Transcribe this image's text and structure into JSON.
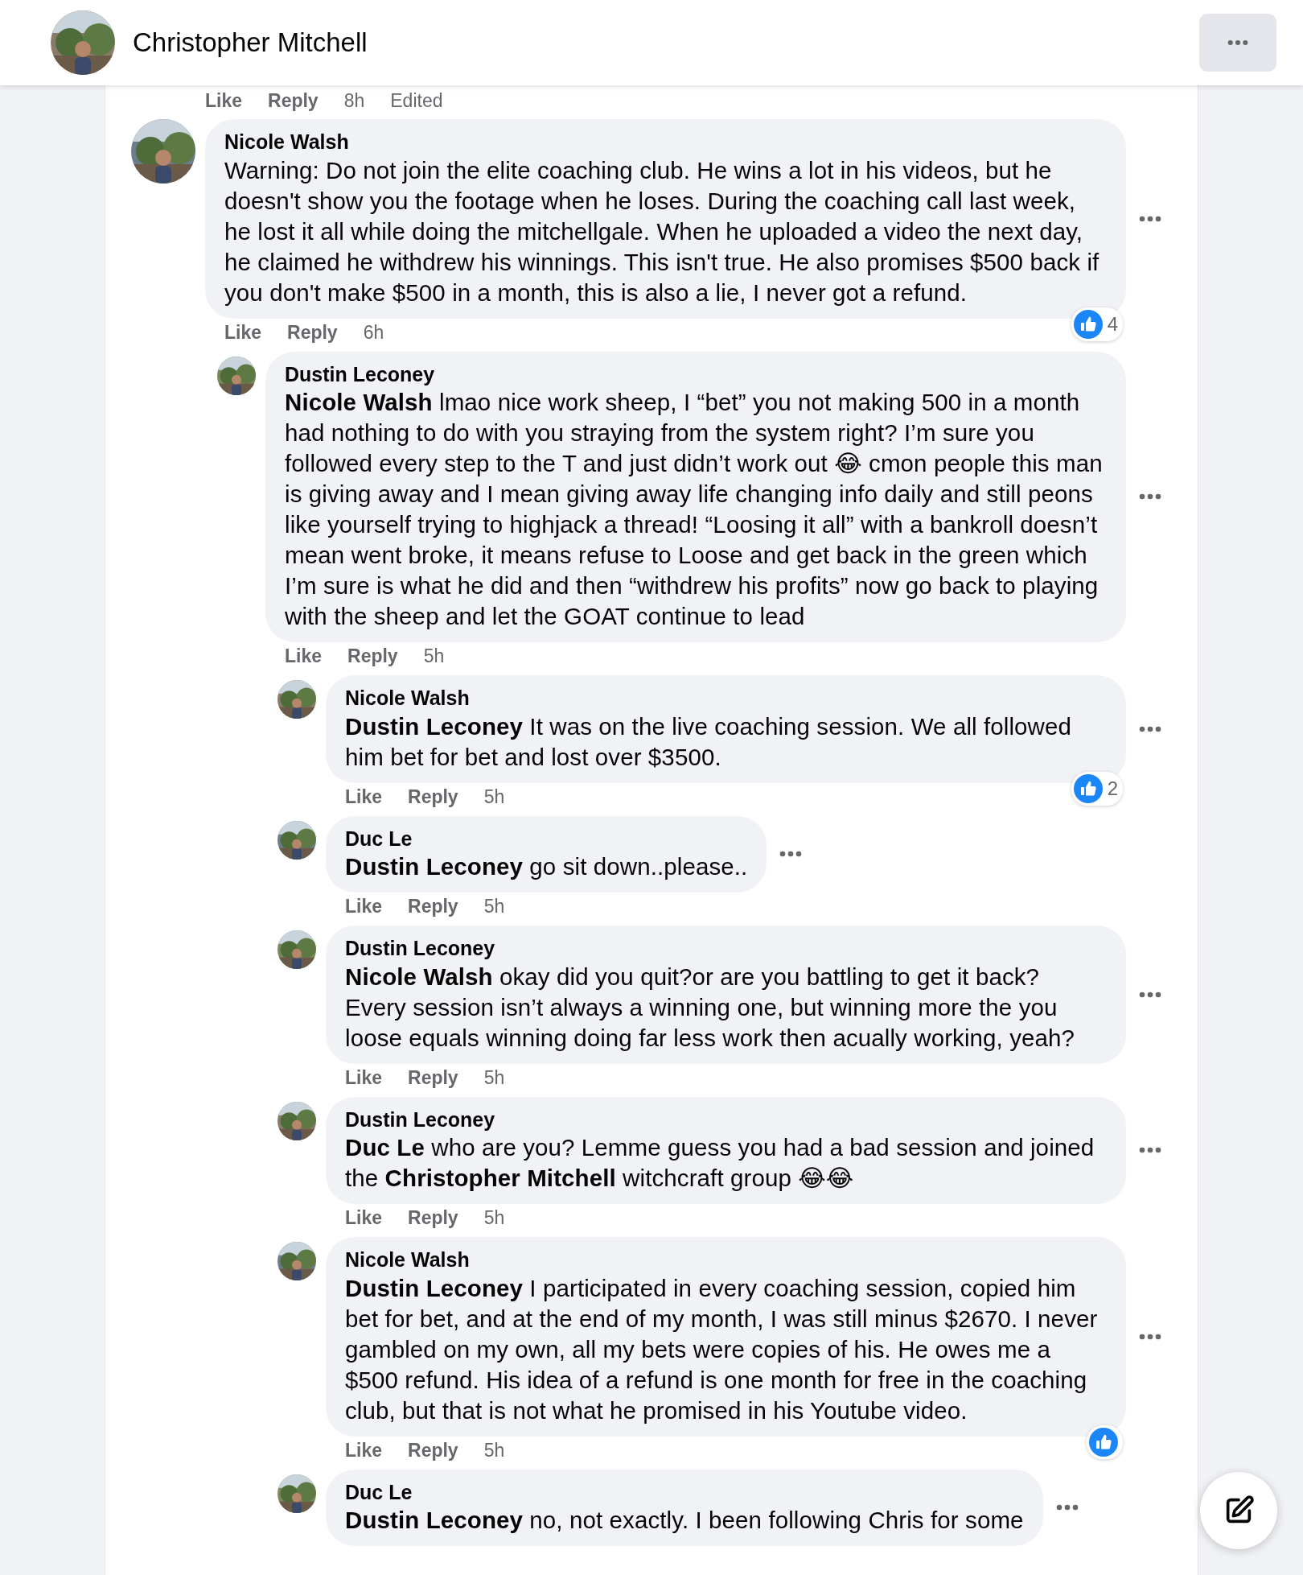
{
  "header": {
    "title": "Christopher Mitchell"
  },
  "top_actions": {
    "like": "Like",
    "reply": "Reply",
    "time": "8h",
    "edited": "Edited"
  },
  "comments": [
    {
      "author": "Nicole Walsh",
      "text": "Warning: Do not join the elite coaching club. He wins a lot in his videos, but he doesn't show you the footage when he loses. During the coaching call last week, he lost it all while doing the mitchellgale. When he uploaded a video the next day, he claimed he withdrew his winnings. This isn't true. He also promises $500 back if you don't make $500 in a month, this is also a lie, I never got a refund.",
      "like": "Like",
      "reply": "Reply",
      "time": "6h",
      "reaction": {
        "kind": "like",
        "count": "4"
      },
      "children": [
        {
          "author": "Dustin Leconey",
          "text": "**Nicole Walsh** lmao nice work sheep, I “bet” you not making 500 in a month had nothing to do with you straying from the system right? I’m sure you followed every step to the T and just didn’t work out 😂 cmon people this man is giving away and I mean giving away life changing info daily and still peons like yourself trying to highjack a thread! “Loosing it all” with a bankroll doesn’t mean went broke, it means refuse to Loose and get back in the green which I’m sure is what he did and then “withdrew his profits” now go back to playing with the sheep and let the GOAT continue to lead",
          "like": "Like",
          "reply": "Reply",
          "time": "5h",
          "children": [
            {
              "author": "Nicole Walsh",
              "text": "**Dustin Leconey** It was on the live coaching session. We all followed him bet for bet and lost over $3500.",
              "like": "Like",
              "reply": "Reply",
              "time": "5h",
              "reaction": {
                "kind": "like",
                "count": "2"
              }
            },
            {
              "author": "Duc Le",
              "text": "**Dustin Leconey** go sit down..please..",
              "like": "Like",
              "reply": "Reply",
              "time": "5h"
            },
            {
              "author": "Dustin Leconey",
              "text": "**Nicole Walsh** okay did you quit?or are you battling to get it back? Every session isn’t always a winning one, but winning more the you loose equals winning doing far less work then acually working, yeah?",
              "like": "Like",
              "reply": "Reply",
              "time": "5h"
            },
            {
              "author": "Dustin Leconey",
              "text": "**Duc Le** who are you? Lemme guess you had a bad session and joined the **Christopher Mitchell** witchcraft group 😂😂",
              "like": "Like",
              "reply": "Reply",
              "time": "5h"
            },
            {
              "author": "Nicole Walsh",
              "text": "**Dustin Leconey** I participated in every coaching session, copied him bet for bet, and at the end of my month, I was still minus $2670. I never gambled on my own, all my bets were copies of his. He owes me a $500 refund. His idea of a refund is one month for free in the coaching club, but that is not what he promised in his Youtube video.",
              "like": "Like",
              "reply": "Reply",
              "time": "5h",
              "reaction": {
                "kind": "like"
              }
            },
            {
              "author": "Duc Le",
              "text": "**Dustin Leconey** no, not exactly. I been following Chris for some"
            }
          ]
        }
      ]
    }
  ]
}
